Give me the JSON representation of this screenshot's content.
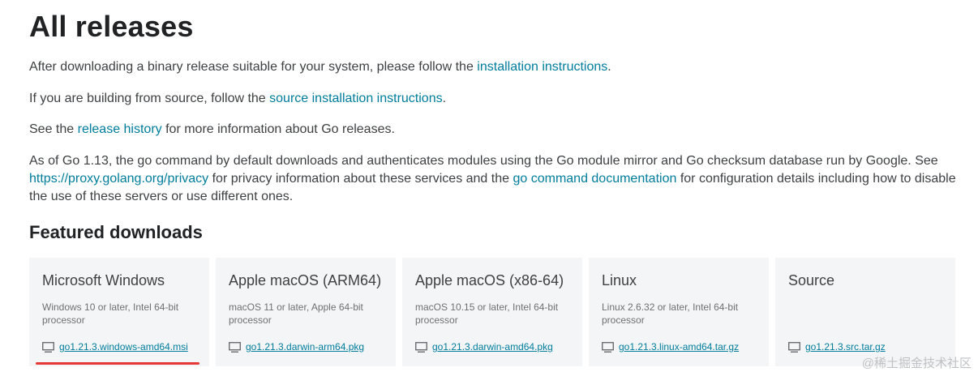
{
  "heading": "All releases",
  "intro": {
    "p1": {
      "before": "After downloading a binary release suitable for your system, please follow the ",
      "link": "installation instructions",
      "after": "."
    },
    "p2": {
      "before": "If you are building from source, follow the ",
      "link": "source installation instructions",
      "after": "."
    },
    "p3": {
      "before": "See the ",
      "link": "release history",
      "after": " for more information about Go releases."
    },
    "p4": {
      "before": "As of Go 1.13, the go command by default downloads and authenticates modules using the Go module mirror and Go checksum database run by Google. See ",
      "link1": "https://proxy.golang.org/privacy",
      "middle": " for privacy information about these services and the ",
      "link2": "go command documentation",
      "after": " for configuration details including how to disable the use of these servers or use different ones."
    }
  },
  "featured": {
    "title": "Featured downloads",
    "cards": [
      {
        "os": "Microsoft Windows",
        "req": "Windows 10 or later, Intel 64-bit processor",
        "file": "go1.21.3.windows-amd64.msi"
      },
      {
        "os": "Apple macOS (ARM64)",
        "req": "macOS 11 or later, Apple 64-bit processor",
        "file": "go1.21.3.darwin-arm64.pkg"
      },
      {
        "os": "Apple macOS (x86-64)",
        "req": "macOS 10.15 or later, Intel 64-bit processor",
        "file": "go1.21.3.darwin-amd64.pkg"
      },
      {
        "os": "Linux",
        "req": "Linux 2.6.32 or later, Intel 64-bit processor",
        "file": "go1.21.3.linux-amd64.tar.gz"
      },
      {
        "os": "Source",
        "req": "",
        "file": "go1.21.3.src.tar.gz"
      }
    ]
  },
  "watermark": "@稀土掘金技术社区",
  "colors": {
    "link": "#007d9c",
    "card_bg": "#f4f5f6",
    "highlight": "#e53935"
  }
}
